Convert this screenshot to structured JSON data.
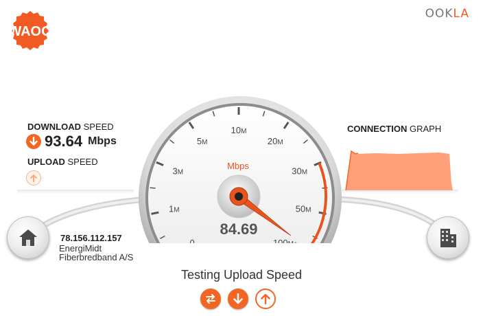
{
  "brand": {
    "logo_text": "WAOO"
  },
  "provider_logo": {
    "text_main": "OOK",
    "text_accent": "LA"
  },
  "download": {
    "title_bold": "DOWNLOAD",
    "title_rest": "SPEED",
    "value": "93.64",
    "unit": "Mbps",
    "icon": "arrow-down-icon"
  },
  "upload": {
    "title_bold": "UPLOAD",
    "title_rest": "SPEED",
    "icon": "arrow-up-icon"
  },
  "gauge": {
    "unit_label": "Mbps",
    "reading": "84.69",
    "ticks": [
      {
        "value": "0",
        "suffix": ""
      },
      {
        "value": "1",
        "suffix": "M"
      },
      {
        "value": "3",
        "suffix": "M"
      },
      {
        "value": "5",
        "suffix": "M"
      },
      {
        "value": "10",
        "suffix": "M"
      },
      {
        "value": "20",
        "suffix": "M"
      },
      {
        "value": "30",
        "suffix": "M"
      },
      {
        "value": "50",
        "suffix": "M"
      },
      {
        "value": "100",
        "suffix": "M+"
      }
    ],
    "needle_fraction": 0.97,
    "accent_color": "#e8541c"
  },
  "connection_graph": {
    "title_bold": "CONNECTION",
    "title_rest": "GRAPH",
    "fill_color": "#ffa07a",
    "stroke_color": "#f26522"
  },
  "host": {
    "ip": "78.156.112.157",
    "isp_line_1": "EnergiMidt",
    "isp_line_2": "Fiberbredband A/S",
    "client_icon": "home-icon",
    "server_icon": "building-icon"
  },
  "status": {
    "text": "Testing Upload Speed",
    "buttons": [
      {
        "name": "ping-test-button",
        "icon": "swap-arrows-icon"
      },
      {
        "name": "download-test-button",
        "icon": "arrow-down-icon"
      },
      {
        "name": "upload-test-button",
        "icon": "arrow-up-icon"
      }
    ]
  },
  "colors": {
    "accent": "#f26522",
    "brand": "#f15a22"
  }
}
